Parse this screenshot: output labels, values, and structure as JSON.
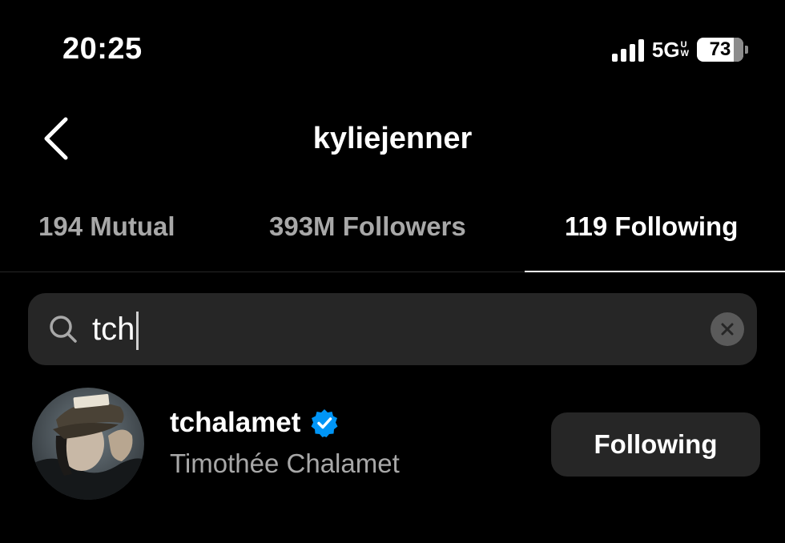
{
  "status_bar": {
    "time": "20:25",
    "network": "5G",
    "network_suffix_top": "U",
    "network_suffix_bottom": "W",
    "battery": "73"
  },
  "header": {
    "title": "kyliejenner",
    "back_icon": "chevron-left-icon"
  },
  "tabs": [
    {
      "label": "194 Mutual",
      "active": false
    },
    {
      "label": "393M Followers",
      "active": false
    },
    {
      "label": "119 Following",
      "active": true
    }
  ],
  "search": {
    "value": "tch",
    "icon": "search-icon",
    "clear_icon": "close-icon"
  },
  "results": [
    {
      "username": "tchalamet",
      "verified": true,
      "full_name": "Timothée Chalamet",
      "action_label": "Following"
    }
  ],
  "colors": {
    "background": "#000000",
    "secondary_text": "#a8a8a8",
    "surface": "#262626",
    "verified_badge": "#0095f6"
  }
}
